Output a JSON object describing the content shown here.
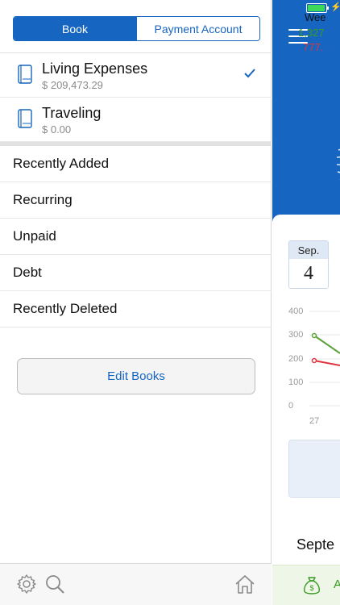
{
  "segments": [
    {
      "label": "Book",
      "active": true
    },
    {
      "label": "Payment Account",
      "active": false
    }
  ],
  "books": [
    {
      "name": "Living Expenses",
      "amount": "$ 209,473.29",
      "selected": true,
      "icon": "book-icon"
    },
    {
      "name": "Traveling",
      "amount": "$ 0.00",
      "selected": false,
      "icon": "book-icon"
    }
  ],
  "menu": [
    {
      "label": "Recently Added"
    },
    {
      "label": "Recurring"
    },
    {
      "label": "Unpaid"
    },
    {
      "label": "Debt"
    },
    {
      "label": "Recently Deleted"
    }
  ],
  "edit_books_label": "Edit Books",
  "bottom_bar": {
    "icons": [
      "gear-icon",
      "search-icon",
      "home-icon"
    ]
  },
  "main": {
    "date": {
      "month": "Sep.",
      "day": "4"
    },
    "chart_axis": [
      "400",
      "300",
      "200",
      "100",
      "0"
    ],
    "x_tick": "27",
    "week": {
      "title": "Wee",
      "income": "1,327",
      "expense": "777."
    },
    "month_title": "Septe",
    "add_label": "A"
  },
  "colors": {
    "accent": "#1665c1",
    "income": "#3a9a23",
    "expense": "#e0333c",
    "battery": "#3bd85a"
  }
}
